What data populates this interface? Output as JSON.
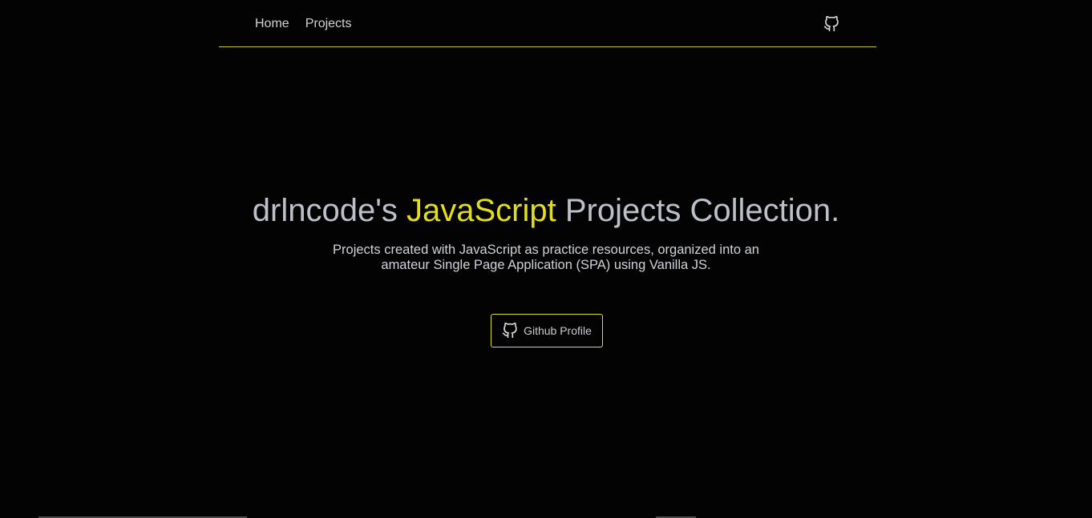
{
  "nav": {
    "links": [
      {
        "label": "Home"
      },
      {
        "label": "Projects"
      }
    ],
    "github_icon": "github-icon"
  },
  "hero": {
    "title_prefix": "drlncode's ",
    "title_accent": "JavaScript",
    "title_suffix": " Projects Collection.",
    "subtitle_line1": "Projects created with JavaScript as practice resources, organized into an",
    "subtitle_line2": "amateur Single Page Application (SPA) using Vanilla JS.",
    "button_label": "Github Profile",
    "button_icon": "github-icon"
  },
  "colors": {
    "background": "#030304",
    "accent": "#e3dd1a",
    "text": "#bcc0c8"
  }
}
